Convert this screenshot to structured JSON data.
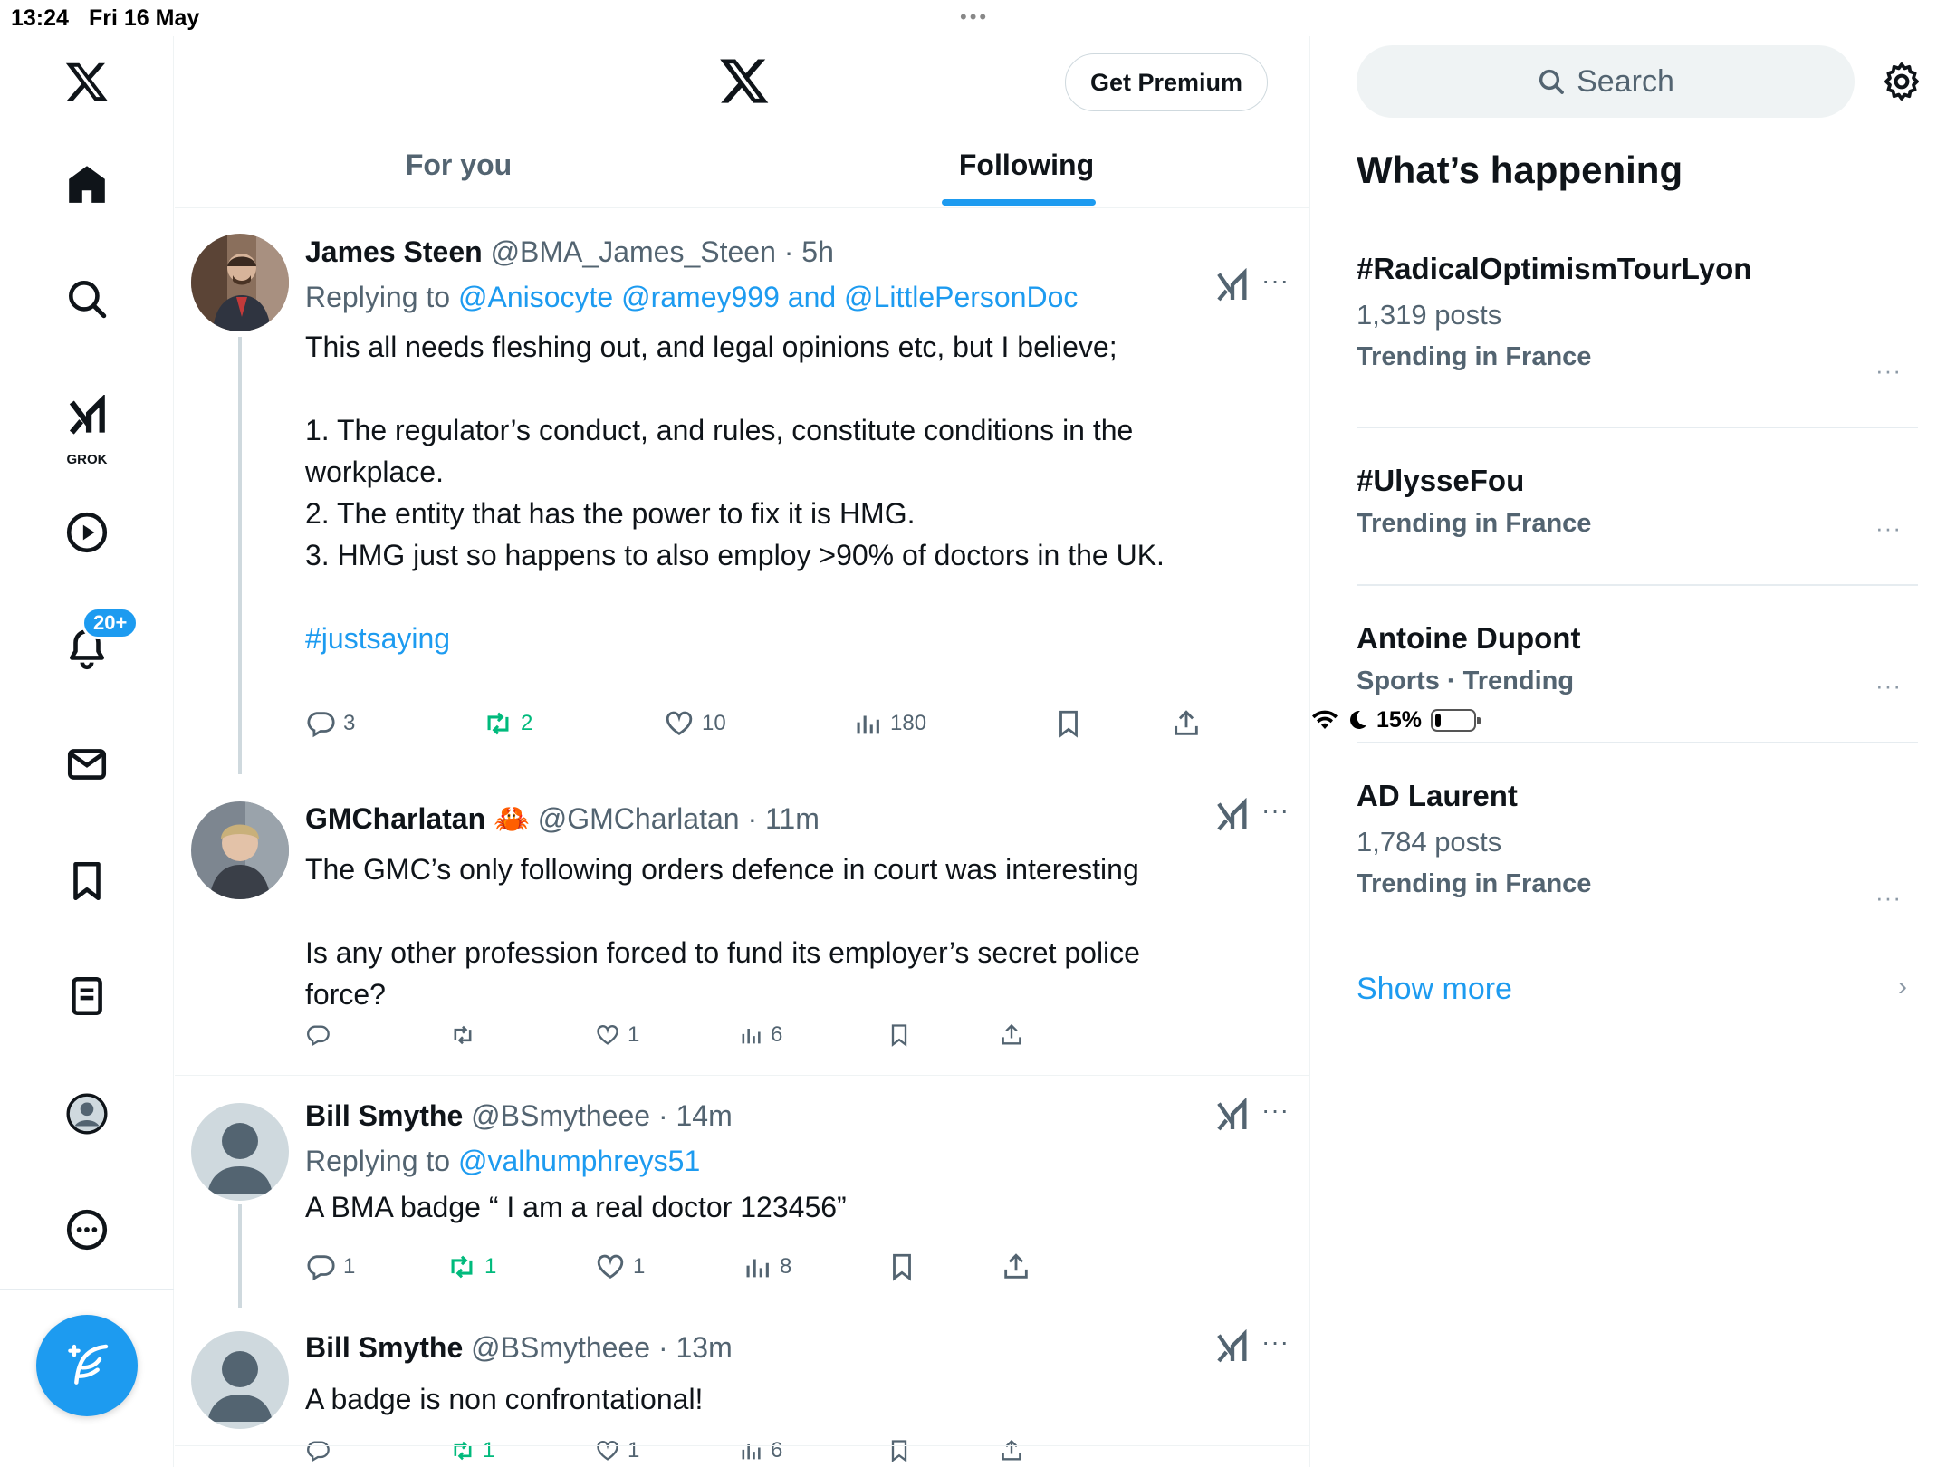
{
  "status_bar": {
    "time": "13:24",
    "date": "Fri 16 May",
    "dots": "•••",
    "battery": "15%",
    "battery_level": 0.15
  },
  "left_nav": {
    "grok_label": "GROK",
    "notifications_badge": "20+"
  },
  "header": {
    "premium_label": "Get Premium",
    "tabs": [
      {
        "label": "For you",
        "active": false
      },
      {
        "label": "Following",
        "active": true
      }
    ]
  },
  "tweets": [
    {
      "name": "James Steen",
      "handle": "@BMA_James_Steen",
      "time": "5h",
      "replying_prefix": "Replying to ",
      "replying_links": "@Anisocyte @ramey999 and @LittlePersonDoc",
      "text_lines": [
        "This all needs fleshing out, and legal opinions etc, but I believe;",
        "",
        "1. The regulator’s conduct, and rules, constitute conditions in the",
        "workplace.",
        "2. The entity that has the power to fix it is HMG.",
        "3. HMG just so happens to also employ >90% of doctors in the UK.",
        ""
      ],
      "hashtag": "#justsaying",
      "replies": "3",
      "reposts": "2",
      "likes": "10",
      "views": "180"
    },
    {
      "name": "GMCharlatan 🦀",
      "handle": "@GMCharlatan",
      "time": "11m",
      "text_lines": [
        "The GMC’s only following orders defence in court was interesting",
        "",
        "Is any other profession forced to fund its employer’s secret police",
        "force?"
      ],
      "replies": "",
      "reposts": "",
      "likes": "1",
      "views": "6"
    },
    {
      "name": "Bill Smythe",
      "handle": "@BSmytheee",
      "time": "14m",
      "replying_prefix": "Replying to ",
      "replying_links": "@valhumphreys51",
      "text_lines": [
        "A BMA badge “ I am a real doctor 123456”"
      ],
      "replies": "1",
      "reposts": "1",
      "likes": "1",
      "views": "8"
    },
    {
      "name": "Bill Smythe",
      "handle": "@BSmytheee",
      "time": "13m",
      "text_lines": [
        "A badge is non confrontational!"
      ],
      "replies": "",
      "reposts": "1",
      "likes": "1",
      "views": "6"
    }
  ],
  "sidebar": {
    "search_placeholder": "Search",
    "whats_happening": "What’s happening",
    "trends": [
      {
        "title": "#RadicalOptimismTourLyon",
        "posts": "1,319 posts",
        "context": "Trending in France"
      },
      {
        "title": "#UlysseFou",
        "posts": "",
        "context": "Trending in France"
      },
      {
        "title": "Antoine Dupont",
        "posts": "",
        "context": "Sports · Trending"
      },
      {
        "title": "AD Laurent",
        "posts": "1,784 posts",
        "context": "Trending in France"
      }
    ],
    "show_more": "Show more"
  },
  "icons": {
    "accent": "#1d9bf0",
    "repost_active": "#00ba7c",
    "names": [
      "x-logo-icon",
      "home-icon",
      "search-icon",
      "grok-icon",
      "video-icon",
      "notifications-icon",
      "messages-icon",
      "bookmarks-icon",
      "lists-icon",
      "profile-icon",
      "more-icon",
      "compose-icon",
      "reply-icon",
      "repost-icon",
      "like-icon",
      "views-icon",
      "bookmark-icon",
      "share-icon",
      "settings-icon",
      "chevron-right-icon"
    ]
  }
}
